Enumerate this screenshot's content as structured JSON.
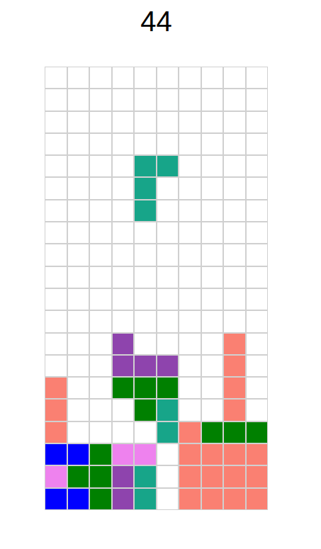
{
  "score": "44",
  "board": [
    [
      null,
      null,
      null,
      null,
      null,
      null,
      null,
      null,
      null,
      null
    ],
    [
      null,
      null,
      null,
      null,
      null,
      null,
      null,
      null,
      null,
      null
    ],
    [
      null,
      null,
      null,
      null,
      null,
      null,
      null,
      null,
      null,
      null
    ],
    [
      null,
      null,
      null,
      null,
      null,
      null,
      null,
      null,
      null,
      null
    ],
    [
      null,
      null,
      null,
      null,
      "#17a589",
      "#17a589",
      null,
      null,
      null,
      null
    ],
    [
      null,
      null,
      null,
      null,
      "#17a589",
      null,
      null,
      null,
      null,
      null
    ],
    [
      null,
      null,
      null,
      null,
      "#17a589",
      null,
      null,
      null,
      null,
      null
    ],
    [
      null,
      null,
      null,
      null,
      null,
      null,
      null,
      null,
      null,
      null
    ],
    [
      null,
      null,
      null,
      null,
      null,
      null,
      null,
      null,
      null,
      null
    ],
    [
      null,
      null,
      null,
      null,
      null,
      null,
      null,
      null,
      null,
      null
    ],
    [
      null,
      null,
      null,
      null,
      null,
      null,
      null,
      null,
      null,
      null
    ],
    [
      null,
      null,
      null,
      null,
      null,
      null,
      null,
      null,
      null,
      null
    ],
    [
      null,
      null,
      null,
      "#8e44ad",
      null,
      null,
      null,
      null,
      "#fa8072",
      null
    ],
    [
      null,
      null,
      null,
      "#8e44ad",
      "#8e44ad",
      "#8e44ad",
      null,
      null,
      "#fa8072",
      null
    ],
    [
      "#fa8072",
      null,
      null,
      "#008000",
      "#008000",
      "#008000",
      null,
      null,
      "#fa8072",
      null
    ],
    [
      "#fa8072",
      null,
      null,
      null,
      "#008000",
      "#17a589",
      null,
      null,
      "#fa8072",
      null
    ],
    [
      "#fa8072",
      null,
      null,
      null,
      null,
      "#17a589",
      "#fa8072",
      "#008000",
      "#008000",
      "#008000"
    ],
    [
      "#0000ff",
      "#0000ff",
      "#008000",
      "#ee82ee",
      "#ee82ee",
      null,
      "#fa8072",
      "#fa8072",
      "#fa8072",
      "#fa8072"
    ],
    [
      "#ee82ee",
      "#008000",
      "#008000",
      "#8e44ad",
      "#17a589",
      null,
      "#fa8072",
      "#fa8072",
      "#fa8072",
      "#fa8072"
    ],
    [
      "#0000ff",
      "#0000ff",
      "#008000",
      "#8e44ad",
      "#17a589",
      null,
      "#fa8072",
      "#fa8072",
      "#fa8072",
      "#fa8072"
    ]
  ]
}
